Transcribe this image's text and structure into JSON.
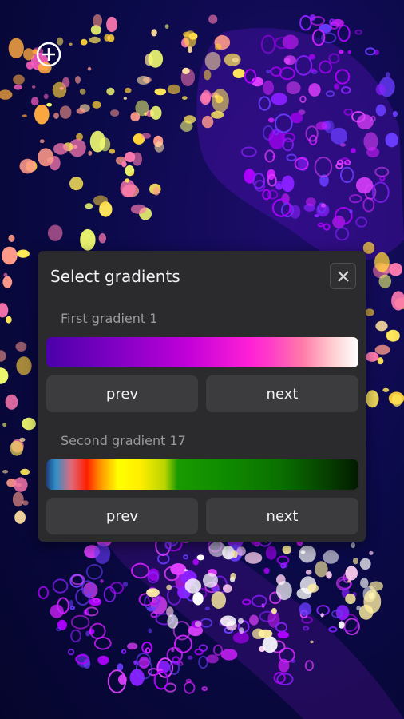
{
  "dialog": {
    "title": "Select gradients",
    "first": {
      "label": "First gradient 1",
      "prev_label": "prev",
      "next_label": "next"
    },
    "second": {
      "label": "Second gradient 17",
      "prev_label": "prev",
      "next_label": "next"
    }
  },
  "icons": {
    "add": "add-circle-icon",
    "close": "close-icon"
  },
  "colors": {
    "dialog_bg": "#2b2b2d",
    "button_bg": "#3c3c3f",
    "background": "#0b0a4a"
  }
}
